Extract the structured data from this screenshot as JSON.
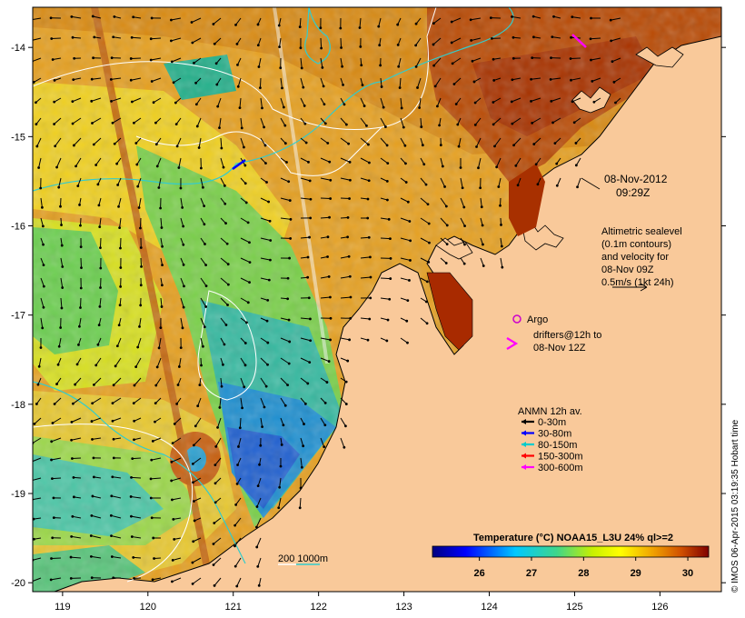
{
  "map": {
    "lon_ticks": [
      "119",
      "120",
      "121",
      "122",
      "123",
      "124",
      "125",
      "126"
    ],
    "lat_ticks": [
      "-14",
      "-15",
      "-16",
      "-17",
      "-18",
      "-19",
      "-20"
    ],
    "timestamp": {
      "date": "08-Nov-2012",
      "time": "09:29Z"
    },
    "altimetry_lines": [
      "Altimetric sealevel",
      "(0.1m contours)",
      "and velocity for",
      "08-Nov 09Z",
      "0.5m/s (1kt 24h)"
    ],
    "argo_label": "Argo",
    "drifters_lines": [
      "drifters@12h to",
      "08-Nov 12Z"
    ],
    "anmn": {
      "title": "ANMN 12h av.",
      "items": [
        {
          "label": "0-30m",
          "color": "#000000"
        },
        {
          "label": "30-80m",
          "color": "#0000ff"
        },
        {
          "label": "80-150m",
          "color": "#00cccc"
        },
        {
          "label": "150-300m",
          "color": "#ff0000"
        },
        {
          "label": "300-600m",
          "color": "#ff00ff"
        }
      ]
    },
    "bathy_legend": "200  1000m",
    "colorbar": {
      "title": "Temperature (°C) NOAA15_L3U 24% ql>=2",
      "ticks": [
        "26",
        "27",
        "28",
        "29",
        "30"
      ],
      "range": [
        25.1,
        30.4
      ]
    },
    "credit": "© IMOS 06-Apr-2015 03:19:35 Hobart time",
    "colors": {
      "land": "#f9c99a",
      "argo": "#cc00cc",
      "bathy_200": "#ffffff",
      "bathy_1000": "#33cccc"
    }
  }
}
